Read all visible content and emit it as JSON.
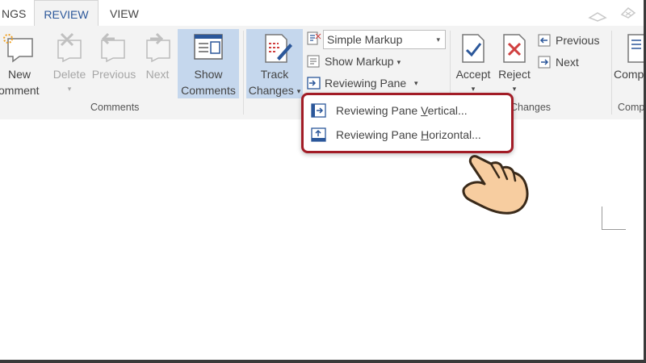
{
  "tabs": [
    {
      "label": "NGS",
      "active": false
    },
    {
      "label": "REVIEW",
      "active": true
    },
    {
      "label": "VIEW",
      "active": false
    }
  ],
  "comments_group": {
    "new_comment": {
      "line1": "New",
      "line2": "omment"
    },
    "delete": {
      "label": "Delete"
    },
    "previous": {
      "label": "Previous"
    },
    "next": {
      "label": "Next"
    },
    "show_comments": {
      "line1": "Show",
      "line2": "Comments"
    },
    "group_label": "Comments"
  },
  "tracking_group": {
    "track_changes": {
      "line1": "Track",
      "line2": "Changes"
    },
    "markup_dropdown": {
      "value": "Simple Markup"
    },
    "show_markup": {
      "label": "Show Markup"
    },
    "reviewing_pane": {
      "label": "Reviewing Pane"
    }
  },
  "changes_group": {
    "accept": {
      "label": "Accept"
    },
    "reject": {
      "label": "Reject"
    },
    "previous": {
      "label": "Previous"
    },
    "next": {
      "label": "Next"
    },
    "group_label_visible": "Changes"
  },
  "compare_group": {
    "compare": {
      "label": "Comp"
    },
    "group_label_visible": "Comp"
  },
  "reviewing_pane_menu": {
    "items": [
      {
        "pre": "Reviewing Pane ",
        "ul": "V",
        "post": "ertical..."
      },
      {
        "pre": "Reviewing Pane ",
        "ul": "H",
        "post": "orizontal..."
      }
    ]
  },
  "colors": {
    "accent": "#2b579a",
    "selected_bg": "#c5d7ed",
    "highlight_border": "#a21c26",
    "ribbon_bg": "#f3f3f3"
  },
  "icons": [
    "new-comment-icon",
    "delete-comment-icon",
    "previous-comment-icon",
    "next-comment-icon",
    "show-comments-icon",
    "track-changes-icon",
    "markup-icon",
    "show-markup-icon",
    "reviewing-pane-icon",
    "accept-icon",
    "reject-icon",
    "previous-change-icon",
    "next-change-icon",
    "compare-icon",
    "pointing-hand-icon"
  ]
}
